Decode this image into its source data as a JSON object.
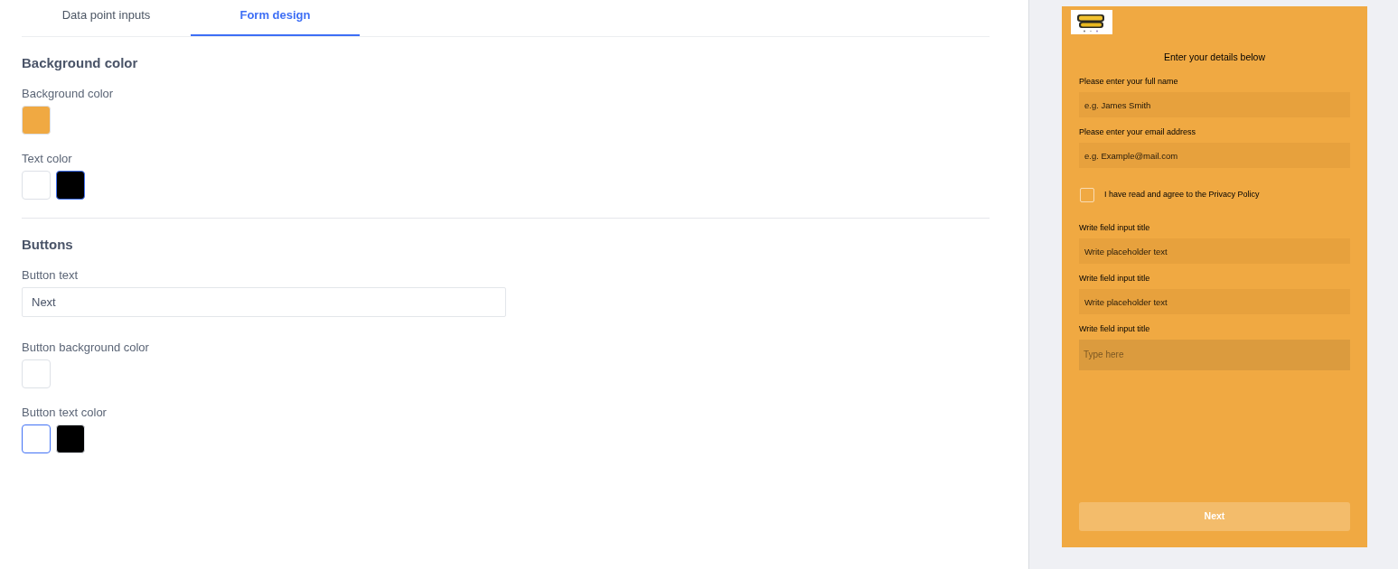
{
  "tabs": [
    {
      "label": "Data point inputs",
      "selected": false
    },
    {
      "label": "Form design",
      "selected": true
    }
  ],
  "sections": [
    {
      "title": "Background color",
      "fields": [
        {
          "kind": "color",
          "label": "Background color",
          "swatches": [
            {
              "color": "#f0a942",
              "selected": false
            }
          ]
        },
        {
          "kind": "color",
          "label": "Text color",
          "swatches": [
            {
              "color": "#ffffff",
              "selected": false
            },
            {
              "color": "#000000",
              "selected": true
            }
          ]
        }
      ]
    },
    {
      "title": "Buttons",
      "fields": [
        {
          "kind": "text",
          "label": "Button text",
          "value": "Next"
        },
        {
          "kind": "color",
          "label": "Button background color",
          "swatches": [
            {
              "color": "#ffffff",
              "selected": false
            }
          ]
        },
        {
          "kind": "color",
          "label": "Button text color",
          "swatches": [
            {
              "color": "#ffffff",
              "selected": true
            },
            {
              "color": "#000000",
              "selected": false
            }
          ]
        }
      ]
    }
  ],
  "preview": {
    "title": "Enter your details below",
    "fields": [
      {
        "kind": "input",
        "label": "Please enter your full name",
        "placeholder": "e.g. James Smith"
      },
      {
        "kind": "input",
        "label": "Please enter your email address",
        "placeholder": "e.g. Example@mail.com"
      },
      {
        "kind": "checkbox",
        "label": "I have read and agree to the Privacy Policy",
        "checked": false
      },
      {
        "kind": "input",
        "label": "Write field input title",
        "placeholder": "Write placeholder text"
      },
      {
        "kind": "input",
        "label": "Write field input title",
        "placeholder": "Write placeholder text"
      },
      {
        "kind": "textarea",
        "label": "Write field input title",
        "placeholder": "Type here"
      }
    ],
    "button": {
      "label": "Next"
    }
  }
}
